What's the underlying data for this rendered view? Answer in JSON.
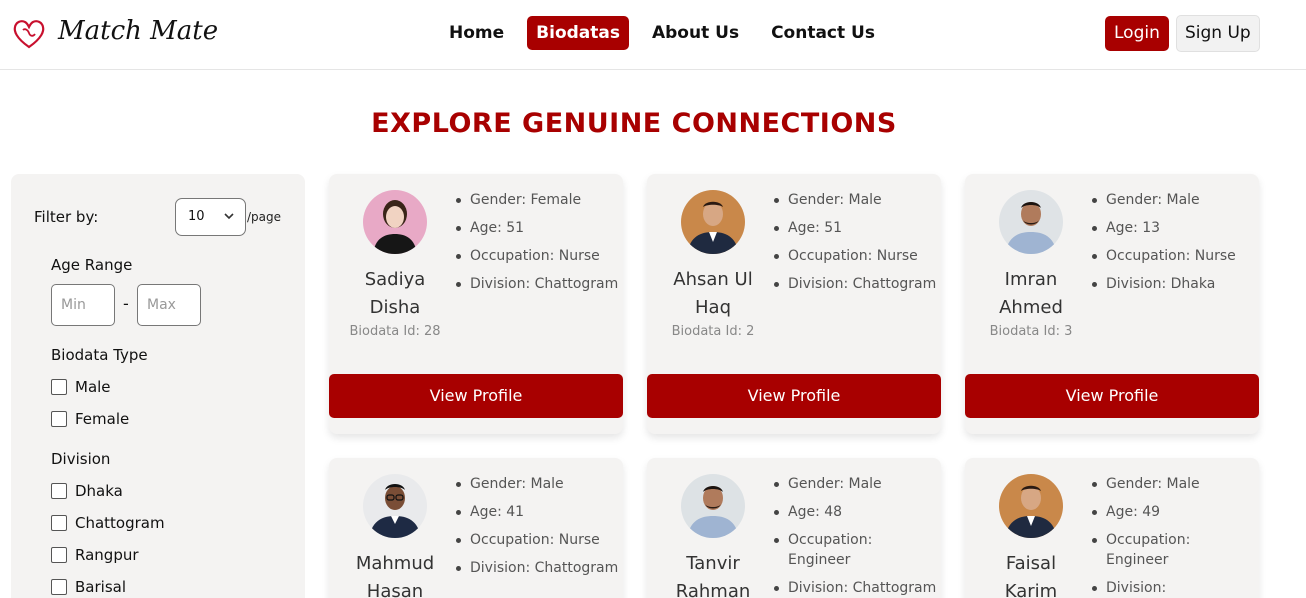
{
  "header": {
    "brand": "Match Mate",
    "nav": [
      {
        "label": "Home",
        "active": false
      },
      {
        "label": "Biodatas",
        "active": true
      },
      {
        "label": "About Us",
        "active": false
      },
      {
        "label": "Contact Us",
        "active": false
      }
    ],
    "login_label": "Login",
    "signup_label": "Sign Up"
  },
  "title": "EXPLORE GENUINE CONNECTIONS",
  "sidebar": {
    "filter_label": "Filter by:",
    "per_page_value": "10",
    "per_page_suffix": "/page",
    "age_range": {
      "heading": "Age Range",
      "min_placeholder": "Min",
      "max_placeholder": "Max",
      "separator": "-"
    },
    "biodata_type": {
      "heading": "Biodata Type",
      "options": [
        "Male",
        "Female"
      ]
    },
    "division": {
      "heading": "Division",
      "options": [
        "Dhaka",
        "Chattogram",
        "Rangpur",
        "Barisal"
      ]
    }
  },
  "view_profile_label": "View Profile",
  "cards": [
    {
      "name_line1": "Sadiya",
      "name_line2": "Disha",
      "biodata_id": "Biodata Id: 28",
      "gender": "Gender: Female",
      "age": "Age: 51",
      "occupation": "Occupation: Nurse",
      "division": "Division: Chattogram"
    },
    {
      "name_line1": "Ahsan Ul",
      "name_line2": "Haq",
      "biodata_id": "Biodata Id: 2",
      "gender": "Gender: Male",
      "age": "Age: 51",
      "occupation": "Occupation: Nurse",
      "division": "Division: Chattogram"
    },
    {
      "name_line1": "Imran",
      "name_line2": "Ahmed",
      "biodata_id": "Biodata Id: 3",
      "gender": "Gender: Male",
      "age": "Age: 13",
      "occupation": "Occupation: Nurse",
      "division": "Division: Dhaka"
    },
    {
      "name_line1": "Mahmud",
      "name_line2": "Hasan",
      "gender": "Gender: Male",
      "age": "Age: 41",
      "occupation": "Occupation: Nurse",
      "division": "Division: Chattogram"
    },
    {
      "name_line1": "Tanvir",
      "name_line2": "Rahman",
      "gender": "Gender: Male",
      "age": "Age: 48",
      "occupation": "Occupation: Engineer",
      "division": "Division: Chattogram"
    },
    {
      "name_line1": "Faisal",
      "name_line2": "Karim",
      "gender": "Gender: Male",
      "age": "Age: 49",
      "occupation": "Occupation: Engineer",
      "division": "Division:"
    }
  ],
  "colors": {
    "accent": "#a80000",
    "card_bg": "#f4f3f2"
  }
}
